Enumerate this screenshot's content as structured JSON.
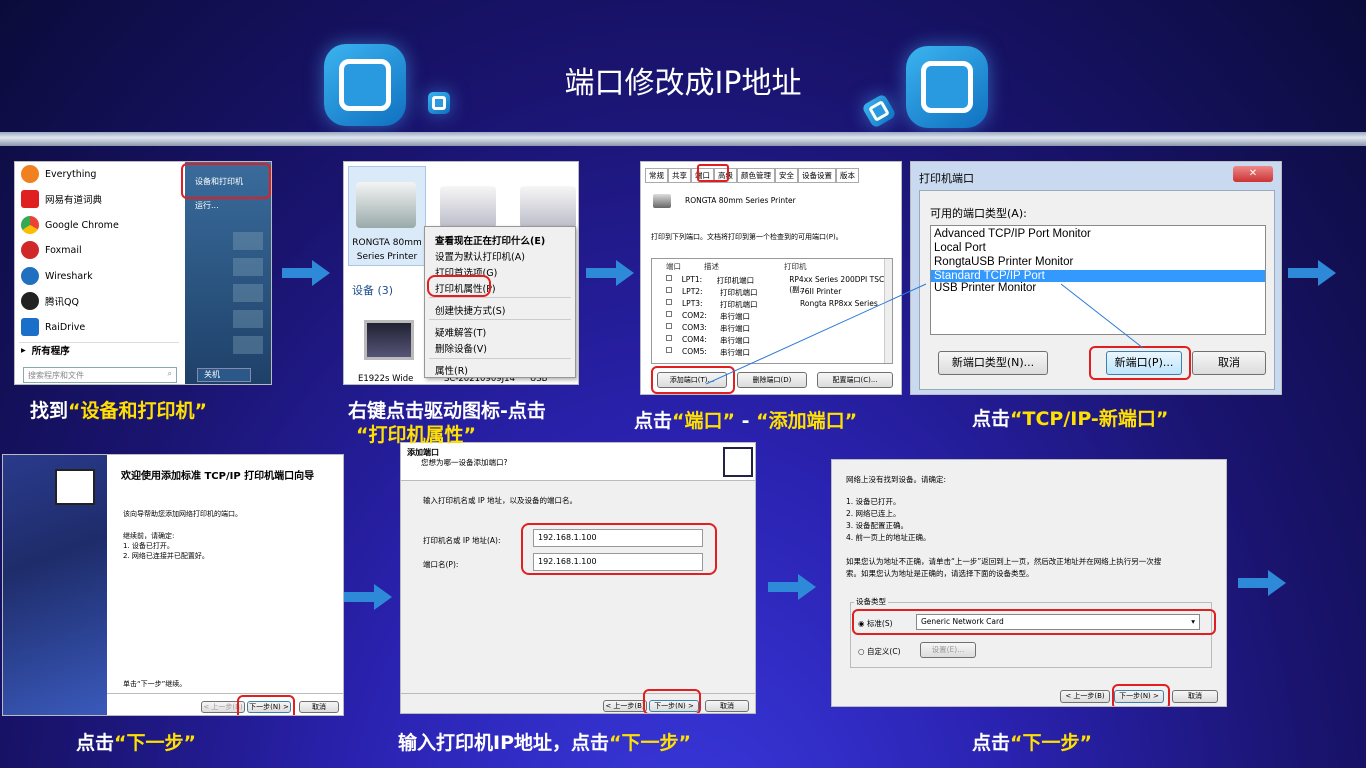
{
  "title": "端口修改成IP地址",
  "captions": {
    "c1a": "找到",
    "c1b": "“设备和打印机”",
    "c2a": "右键点击驱动图标-点击",
    "c2b": "“打印机属性”",
    "c3a": "点击",
    "c3b": "“端口”",
    "c3c": "-",
    "c3d": "“添加端口”",
    "c4a": "点击",
    "c4b": "“TCP/IP-新端口”",
    "c5a": "点击",
    "c5b": "“下一步”",
    "c6a": "输入打印机IP地址，点击",
    "c6b": "“下一步”",
    "c7a": "点击",
    "c7b": "“下一步”"
  },
  "start_menu": {
    "programs": [
      "Everything",
      "网易有道词典",
      "Google Chrome",
      "Foxmail",
      "Wireshark",
      "腾讯QQ",
      "RaiDrive"
    ],
    "all_programs": "所有程序",
    "search_placeholder": "搜索程序和文件",
    "right_items": [
      "设备和打印机",
      "运行..."
    ],
    "shutdown": "关机"
  },
  "context_menu": {
    "printer_label": "RONGTA 80mm Series Printer",
    "items": [
      "查看现在正在打印什么(E)",
      "设置为默认打印机(A)",
      "打印首选项(G)",
      "打印机属性(P)",
      "创建快捷方式(S)",
      "疑难解答(T)",
      "删除设备(V)",
      "属性(R)"
    ],
    "devices_header": "设备 (3)",
    "bottom_labels": [
      "E1922s Wide",
      "SC-20210909J14",
      "USB Optical"
    ]
  },
  "ports_tab": {
    "tabs": [
      "常规",
      "共享",
      "端口",
      "高级",
      "颜色管理",
      "安全",
      "设备设置",
      "版本"
    ],
    "printer_name": "RONGTA 80mm Series Printer",
    "instruction": "打印到下列端口。文档将打印到第一个检查到的可用端口(P)。",
    "headers": [
      "端口",
      "描述",
      "打印机"
    ],
    "rows": [
      [
        "LPT1:",
        "打印机端口",
        "RP4xx Series 200DPI TSC (副..."
      ],
      [
        "LPT2:",
        "打印机端口",
        "76II Printer"
      ],
      [
        "LPT3:",
        "打印机端口",
        "Rongta RP8xx Series"
      ],
      [
        "COM2:",
        "串行端口",
        ""
      ],
      [
        "COM3:",
        "串行端口",
        ""
      ],
      [
        "COM4:",
        "串行端口",
        ""
      ],
      [
        "COM5:",
        "串行端口",
        ""
      ]
    ],
    "buttons": [
      "添加端口(T)...",
      "删除端口(D)",
      "配置端口(C)..."
    ]
  },
  "printer_ports": {
    "title": "打印机端口",
    "label": "可用的端口类型(A):",
    "types": [
      "Advanced TCP/IP Port Monitor",
      "Local Port",
      "RongtaUSB Printer Monitor",
      "Standard TCP/IP Port",
      "USB Printer Monitor"
    ],
    "selected_index": 3,
    "buttons": [
      "新端口类型(N)...",
      "新端口(P)...",
      "取消"
    ]
  },
  "wizard1": {
    "heading": "欢迎使用添加标准 TCP/IP 打印机端口向导",
    "line1": "该向导帮助您添加网络打印机的端口。",
    "line2": "继续前，请确定:",
    "item1": "1.  设备已打开。",
    "item2": "2.  网络已连接并已配置好。",
    "footer": "单击“下一步”继续。",
    "buttons": [
      "< 上一步(B)",
      "下一步(N) >",
      "取消"
    ]
  },
  "wizard2": {
    "heading": "添加端口",
    "sub": "您想为哪一设备添加端口?",
    "instruction": "输入打印机名或 IP 地址，以及设备的端口名。",
    "label_ip": "打印机名或 IP 地址(A):",
    "label_port": "端口名(P):",
    "ip_value": "192.168.1.100",
    "port_value": "192.168.1.100",
    "buttons": [
      "< 上一步(B)",
      "下一步(N) >",
      "取消"
    ]
  },
  "wizard3": {
    "line0": "网络上没有找到设备。请确定:",
    "items": [
      "1.  设备已打开。",
      "2.  网络已连上。",
      "3.  设备配置正确。",
      "4.  前一页上的地址正确。"
    ],
    "para1": "如果您认为地址不正确，请单击“上一步”返回到上一页，然后改正地址并在网络上执行另一次搜",
    "para2": "索。如果您认为地址是正确的，请选择下面的设备类型。",
    "group": "设备类型",
    "radio1": "标准(S)",
    "select_value": "Generic Network Card",
    "radio2": "自定义(C)",
    "settings_btn": "设置(E)...",
    "buttons": [
      "< 上一步(B)",
      "下一步(N) >",
      "取消"
    ]
  },
  "colors": {
    "caption_yellow": "#ffe000",
    "highlight_red": "#e02020",
    "select_blue": "#3399ff"
  }
}
